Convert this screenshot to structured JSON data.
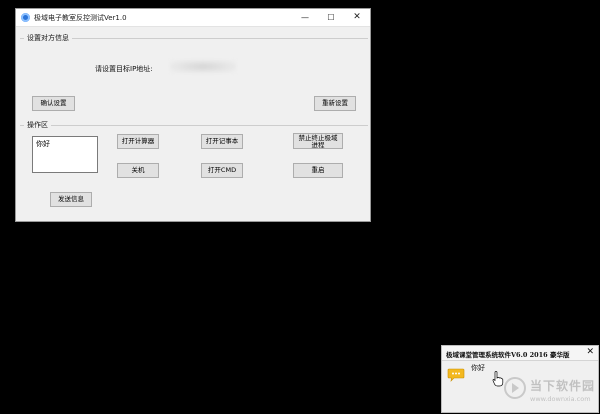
{
  "window": {
    "title": "极域电子教室反控测试Ver1.0",
    "controls": {
      "minimize": "—",
      "maximize": "☐",
      "close": "✕"
    }
  },
  "settings_group": {
    "label": "设置对方信息",
    "ip_prompt": "请设置目标IP地址:",
    "confirm_button": "确认设置",
    "reset_button": "重新设置"
  },
  "ops_group": {
    "label": "操作区",
    "message_text": "你好",
    "buttons": {
      "open_calculator": "打开计算器",
      "open_notepad": "打开记事本",
      "kill_process": "禁止终止极域进程",
      "shutdown": "关机",
      "open_cmd": "打开CMD",
      "restart": "重启",
      "send_message": "发送信息"
    }
  },
  "notification": {
    "title": "极域课堂管理系统软件V6.0 2016 豪华版",
    "close": "✕",
    "message": "你好"
  },
  "watermark": {
    "text": "当下软件园",
    "url": "www.downxia.com"
  }
}
